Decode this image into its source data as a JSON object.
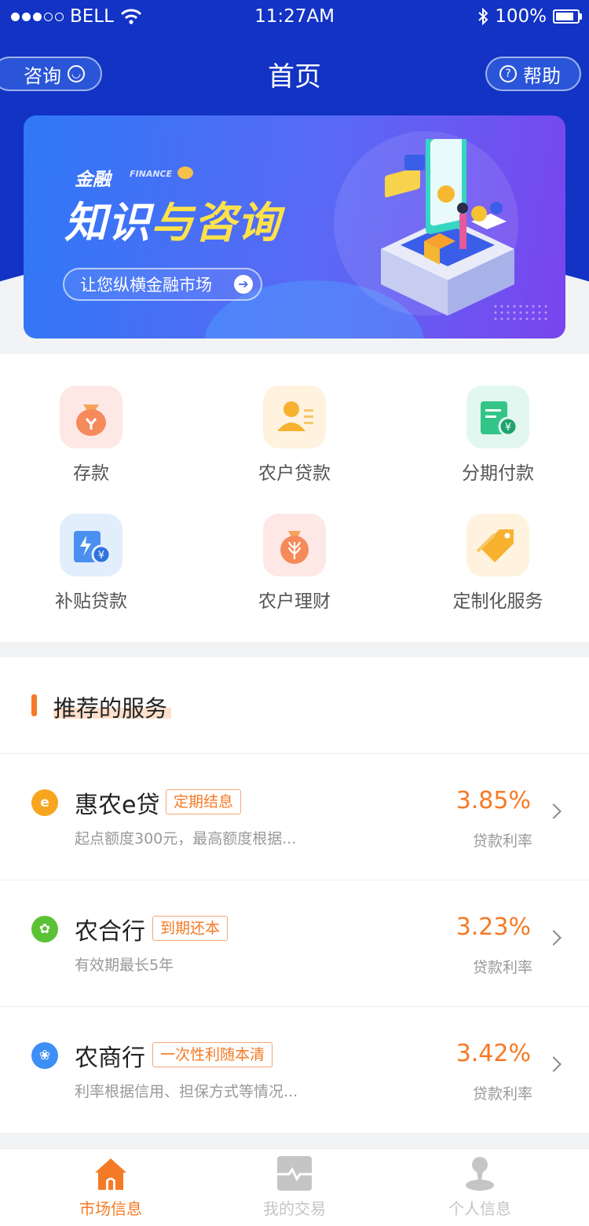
{
  "status_bar": {
    "carrier": "BELL",
    "time": "11:27AM",
    "battery": "100%",
    "battery_level": 1.0
  },
  "header": {
    "title": "首页",
    "left_button": "咨询",
    "right_button": "帮助"
  },
  "banner": {
    "small_title": "金融",
    "small_en": "FINANCE",
    "title_white": "知识",
    "title_yellow": "与咨询",
    "button": "让您纵横金融市场"
  },
  "menu": {
    "items": [
      {
        "label": "存款",
        "icon": "money-bag-icon"
      },
      {
        "label": "农户贷款",
        "icon": "farmer-user-icon"
      },
      {
        "label": "分期付款",
        "icon": "installment-icon"
      },
      {
        "label": "补贴贷款",
        "icon": "subsidy-icon"
      },
      {
        "label": "农户理财",
        "icon": "grain-bag-icon"
      },
      {
        "label": "定制化服务",
        "icon": "tag-icon"
      }
    ]
  },
  "recommend": {
    "title": "推荐的服务",
    "items": [
      {
        "name": "惠农e贷",
        "tag": "定期结息",
        "desc": "起点额度300元，最高额度根据...",
        "rate": "3.85%",
        "rate_label": "贷款利率",
        "icon_text": "e",
        "icon_color": "#f7a51f"
      },
      {
        "name": "农合行",
        "tag": "到期还本",
        "desc": "有效期最长5年",
        "rate": "3.23%",
        "rate_label": "贷款利率",
        "icon_text": "✿",
        "icon_color": "#5bc236"
      },
      {
        "name": "农商行",
        "tag": "一次性利随本清",
        "desc": "利率根据信用、担保方式等情况...",
        "rate": "3.42%",
        "rate_label": "贷款利率",
        "icon_text": "❀",
        "icon_color": "#3d8ef5"
      }
    ]
  },
  "tabbar": {
    "tabs": [
      {
        "label": "市场信息",
        "active": true
      },
      {
        "label": "我的交易",
        "active": false
      },
      {
        "label": "个人信息",
        "active": false
      }
    ]
  },
  "colors": {
    "header_blue": "#1233c4",
    "accent_orange": "#f57a25",
    "inactive_gray": "#c5c5c5"
  }
}
